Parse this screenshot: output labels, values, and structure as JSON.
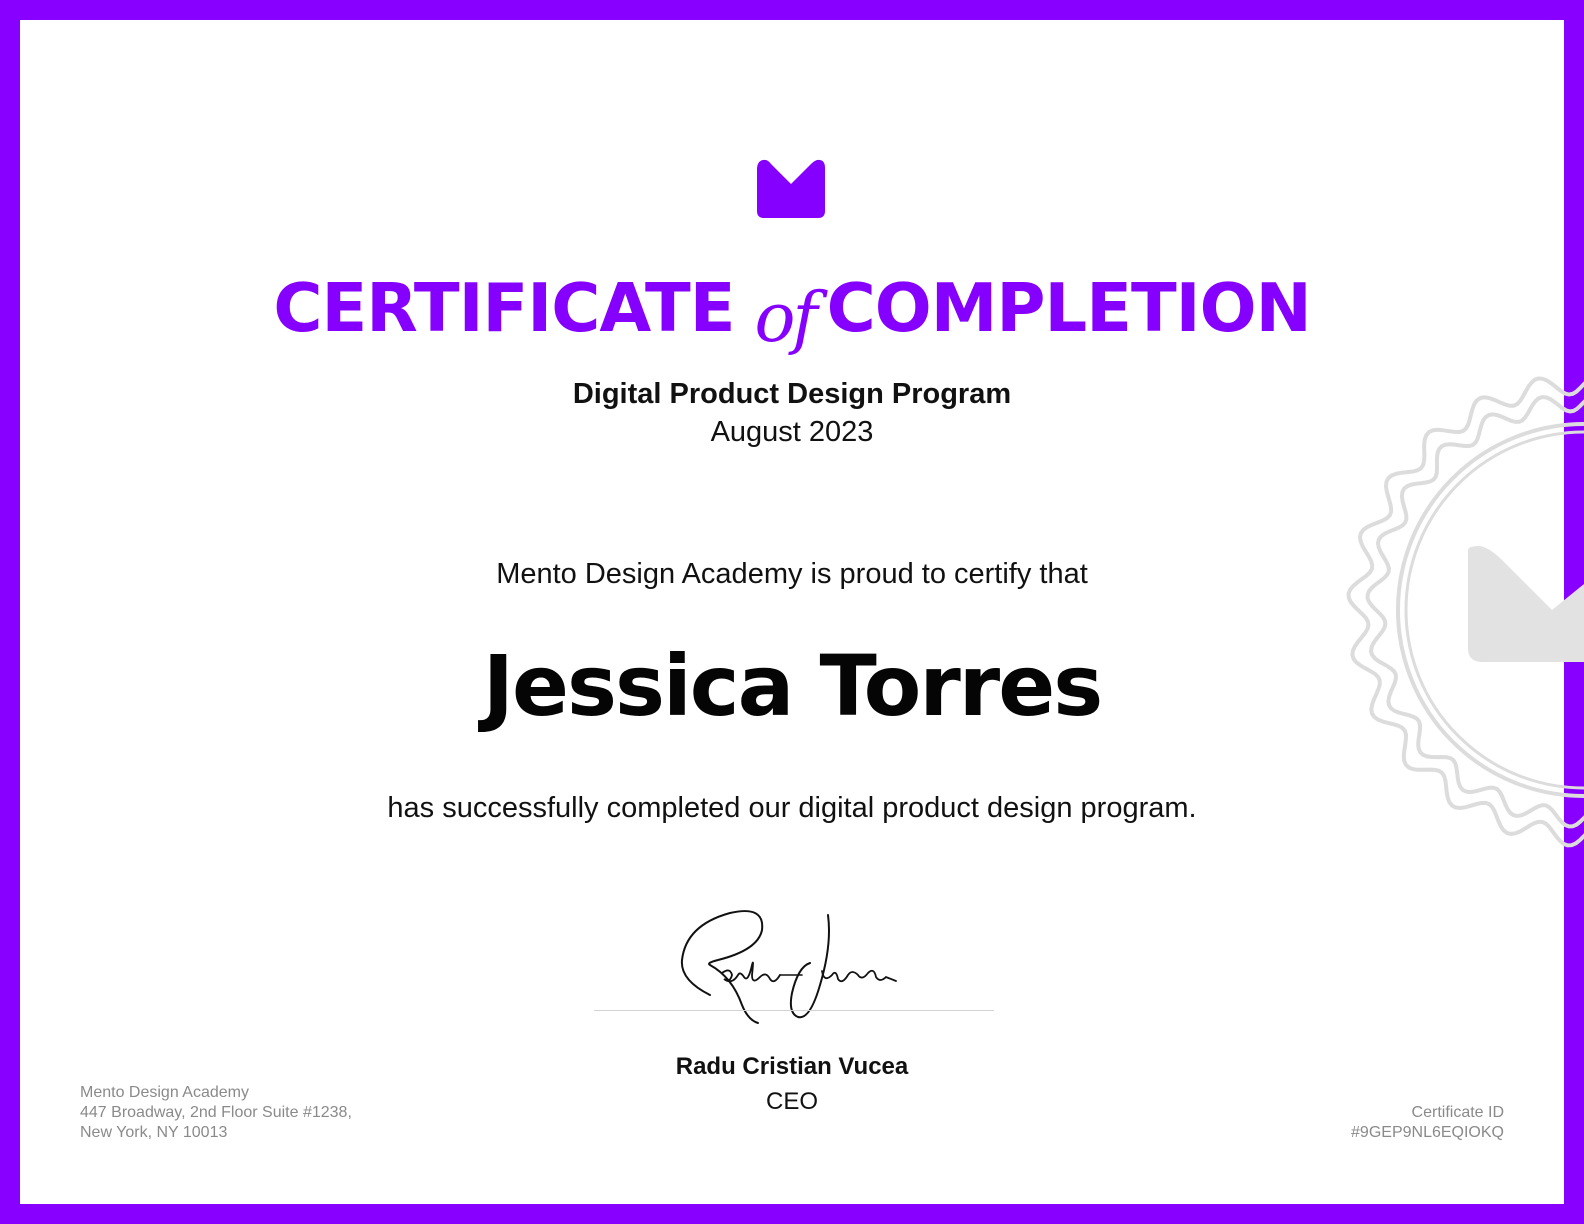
{
  "certificate": {
    "title_part1": "CERTIFICATE",
    "title_connector": "of",
    "title_part2": "COMPLETION",
    "program_name": "Digital Product Design Program",
    "date": "August 2023",
    "intro": "Mento Design Academy is proud to certify that",
    "recipient_name": "Jessica Torres",
    "completion_statement": "has successfully completed our digital product design program.",
    "signature_text": "Radu Vucea",
    "signer_name": "Radu Cristian Vucea",
    "signer_title": "CEO"
  },
  "footer": {
    "org_name": "Mento Design Academy",
    "address_line1": "447 Broadway, 2nd Floor Suite #1238,",
    "address_line2": "New York, NY 10013",
    "certificate_id_label": "Certificate ID",
    "certificate_id": "#9GEP9NL6EQIOKQ"
  },
  "icons": {
    "logo": "mento-logo-icon",
    "seal": "seal-badge-icon"
  },
  "colors": {
    "border": "#8800ff",
    "accent": "#8600ff",
    "text": "#111111",
    "muted": "#8a8a8a",
    "seal": "#e2e2e2"
  }
}
